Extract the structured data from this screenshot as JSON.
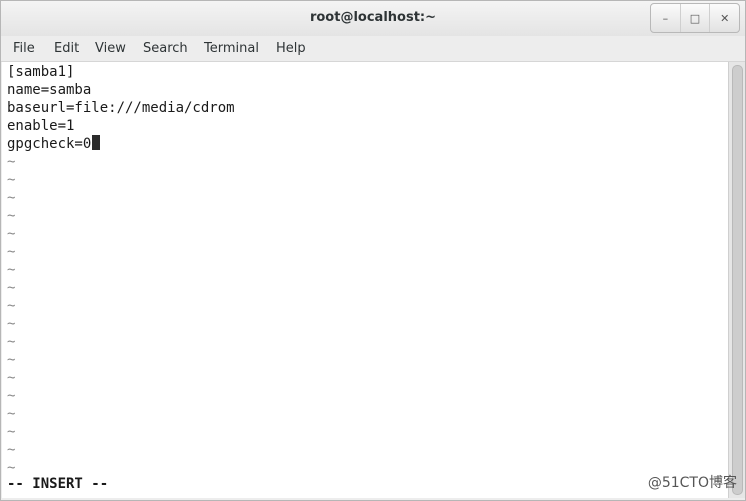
{
  "window": {
    "title": "root@localhost:~"
  },
  "window_controls": {
    "minimize": "–",
    "maximize": "□",
    "close": "✕"
  },
  "menu": [
    "File",
    "Edit",
    "View",
    "Search",
    "Terminal",
    "Help"
  ],
  "editor": {
    "lines": [
      "[samba1]",
      "name=samba",
      "baseurl=file:///media/cdrom",
      "enable=1",
      "gpgcheck=0"
    ],
    "tilde": "~",
    "tilde_count": 18,
    "mode": "-- INSERT --"
  },
  "watermark": "@51CTO博客"
}
